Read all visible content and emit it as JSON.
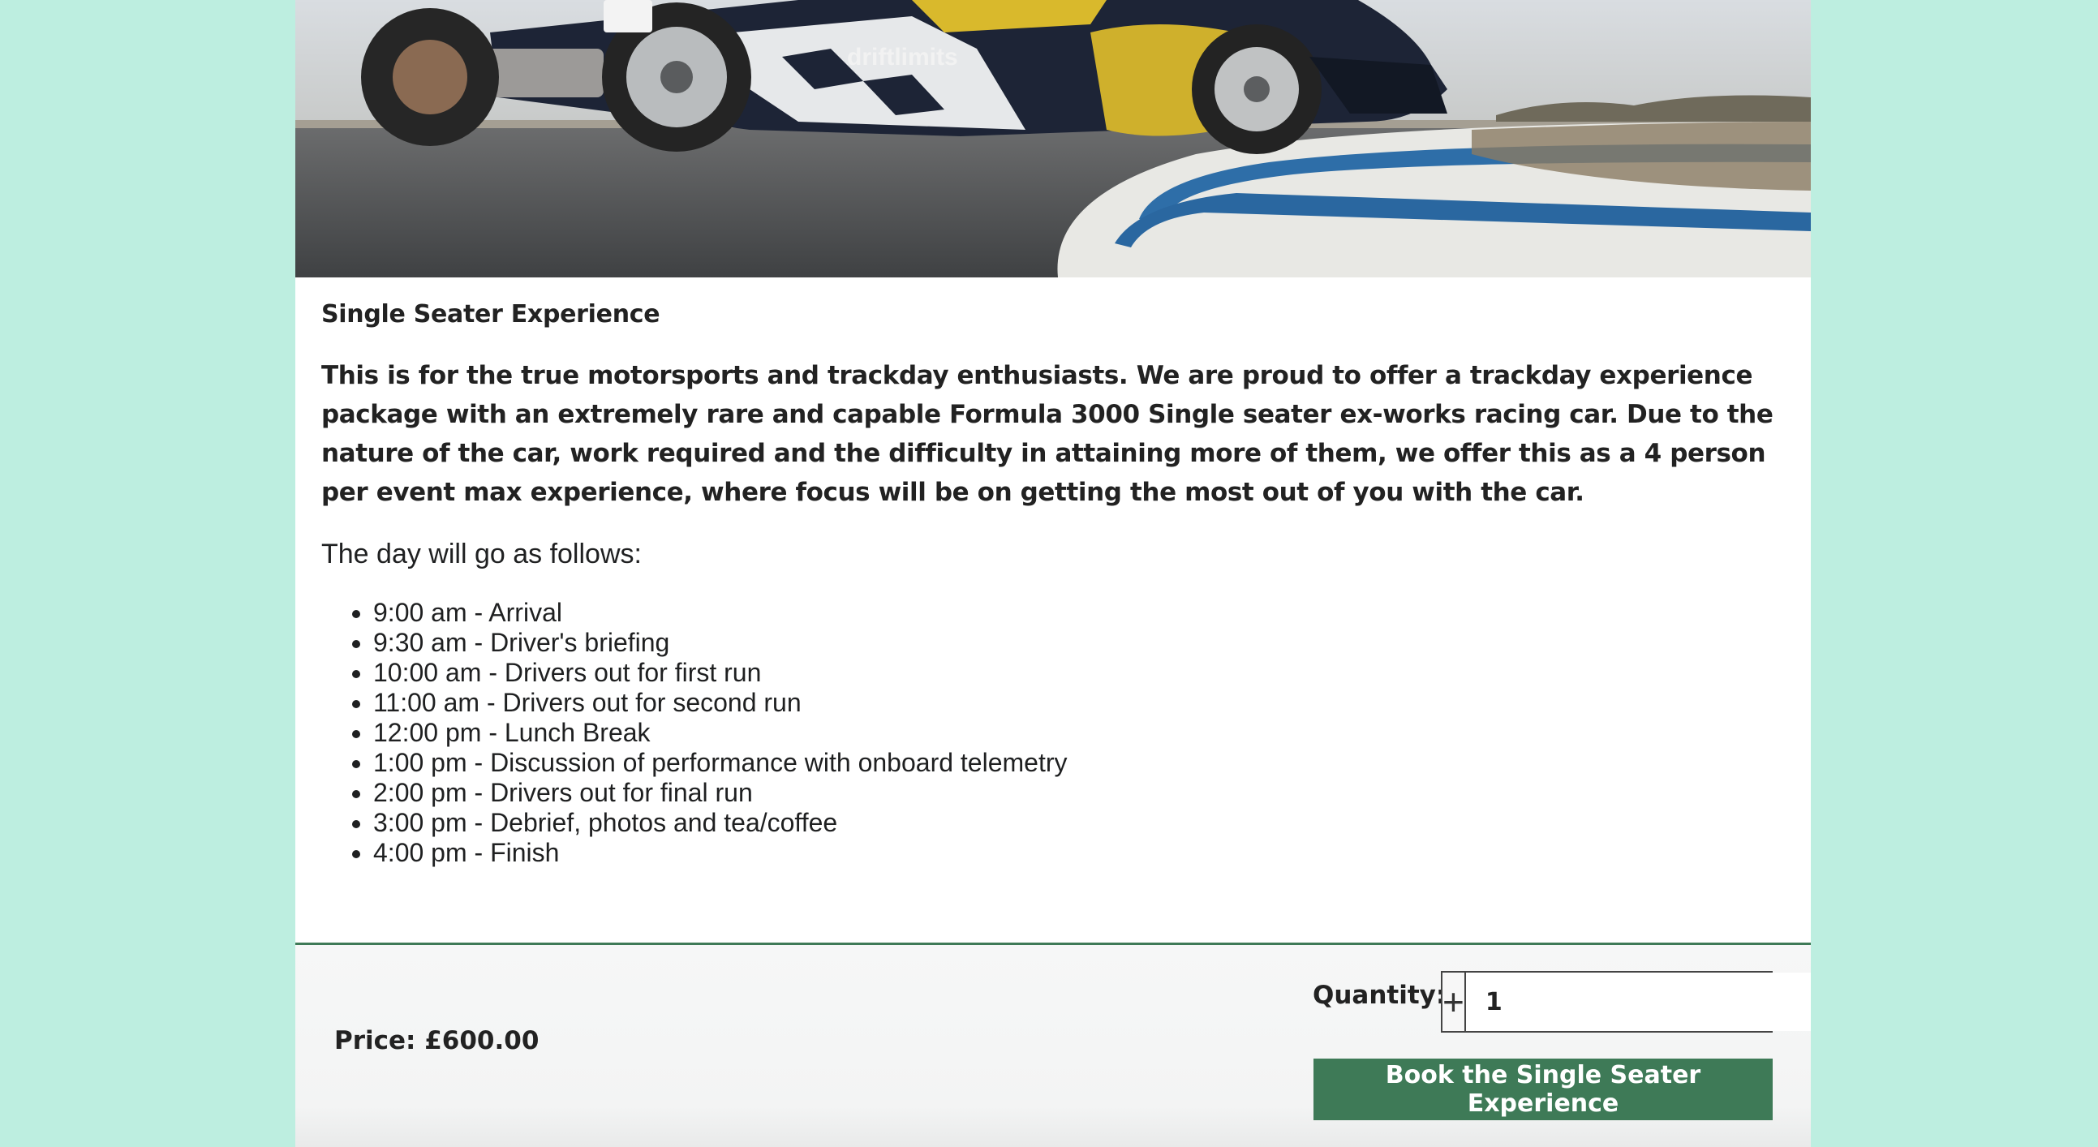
{
  "colors": {
    "background": "#bdeee0",
    "accent": "#3e7a57",
    "button_text": "#ffffff"
  },
  "hero": {
    "image_label": "single-seater-race-car-photo",
    "livery_text": "driftlimits"
  },
  "product": {
    "title": "Single Seater Experience",
    "intro": "This is for the true motorsports and trackday enthusiasts. We are proud to offer a trackday experience package with an extremely rare and capable Formula 3000 Single seater ex-works racing car. Due to the nature of the car, work required and the difficulty in attaining more of them, we offer this as a 4 person per event max experience, where focus will be on getting the most out of you with the car.",
    "day_heading": "The day will go as follows:",
    "schedule": [
      "9:00 am - Arrival",
      "9:30 am - Driver's briefing",
      "10:00 am - Drivers out for first run",
      "11:00 am - Drivers out for second run",
      "12:00 pm - Lunch Break",
      "1:00 pm - Discussion of performance with onboard telemetry",
      "2:00 pm - Drivers out for final run",
      "3:00 pm - Debrief, photos and tea/coffee",
      "4:00 pm - Finish"
    ]
  },
  "purchase": {
    "price_label": "Price: £600.00",
    "quantity_label": "Quantity:",
    "quantity_value": "1",
    "plus_symbol": "+",
    "minus_symbol": "−",
    "book_button": "Book the Single Seater Experience"
  }
}
